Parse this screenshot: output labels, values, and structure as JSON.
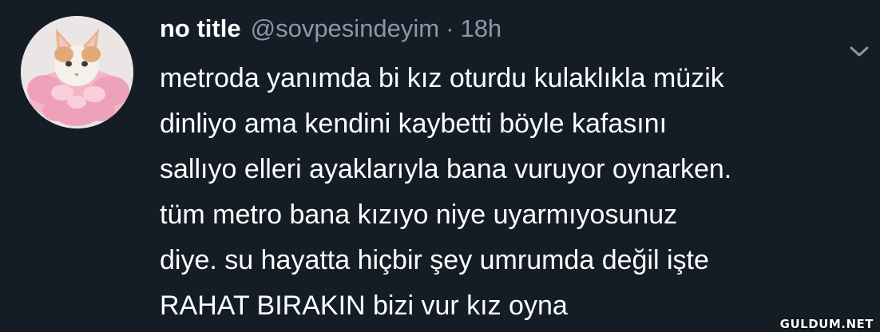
{
  "tweet": {
    "display_name": "no title",
    "handle": "@sovpesindeyim",
    "separator": "·",
    "time": "18h",
    "text_lines": [
      "metroda yanımda bi kız oturdu kulaklıkla müzik",
      "dinliyo ama kendini kaybetti böyle kafasını",
      "sallıyo elleri ayaklarıyla bana vuruyor oynarken.",
      "tüm metro bana kızıyo niye uyarmıyosunuz",
      "diye. su hayatta hiçbir şey umrumda değil işte",
      "RAHAT BIRAKIN bizi vur kız oyna"
    ],
    "avatar_icon": "cat-in-pink-tutu-avatar",
    "menu_icon": "chevron-down-icon"
  },
  "watermark": {
    "text": "GULDUM.NET"
  },
  "colors": {
    "background": "#141d26",
    "primary_text": "#ffffff",
    "secondary_text": "#8899a6"
  }
}
